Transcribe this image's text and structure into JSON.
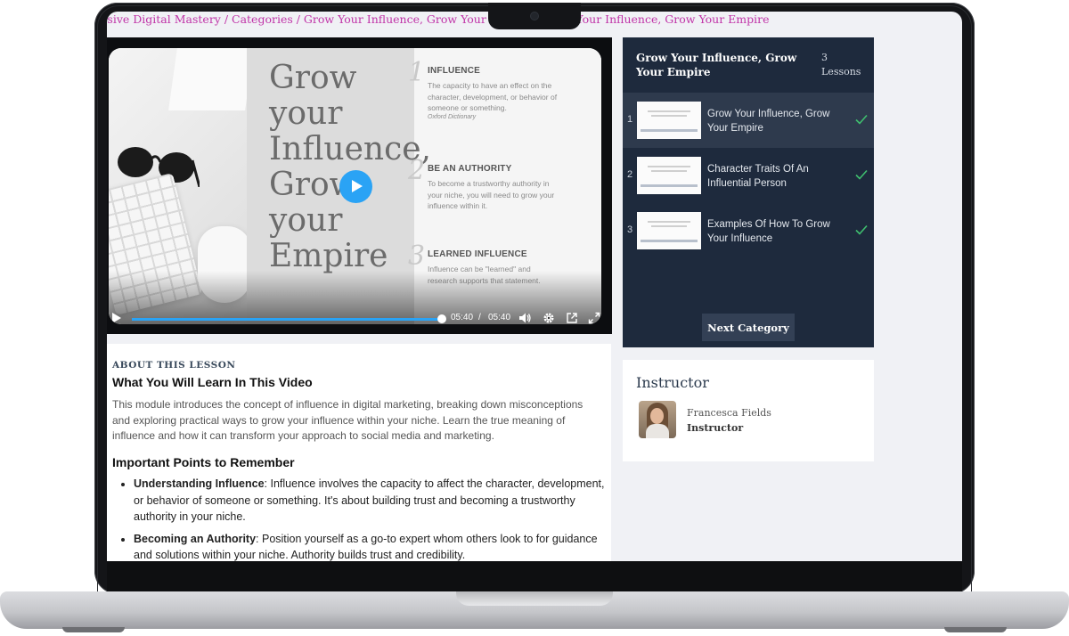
{
  "breadcrumb": "ssive Digital Mastery / Categories / Grow Your Influence, Grow Your Empire / Grow Your Influence, Grow Your Empire",
  "video": {
    "slide_title": "Grow your Influence, Grow your Empire",
    "slide_items": [
      {
        "num": "1",
        "heading": "INFLUENCE",
        "text": "The capacity to have an effect on the character, development, or behavior of someone or something.",
        "cite": "Oxford Dictionary"
      },
      {
        "num": "2",
        "heading": "BE AN AUTHORITY",
        "text": "To become a trustworthy authority in your niche, you will need to grow your influence within it.",
        "cite": ""
      },
      {
        "num": "3",
        "heading": "LEARNED INFLUENCE",
        "text": "Influence can be \"learned\" and research supports that statement.",
        "cite": ""
      }
    ],
    "current_time": "05:40",
    "separator": "/",
    "duration": "05:40",
    "progress": 1.0,
    "accent_color": "#2aa3f5"
  },
  "lesson": {
    "section_label": "ABOUT THIS LESSON",
    "heading": "What You Will Learn In This Video",
    "description": "This module introduces the concept of influence in digital marketing, breaking down misconceptions and exploring practical ways to grow your influence within your niche. Learn the true meaning of influence and how it can transform your approach to social media and marketing.",
    "points_heading": "Important Points to Remember",
    "points": [
      {
        "term": "Understanding Influence",
        "text": ": Influence involves the capacity to affect the character, development, or behavior of someone or something. It's about building trust and becoming a trustworthy authority in your niche."
      },
      {
        "term": "Becoming an Authority",
        "text": ": Position yourself as a go-to expert whom others look to for guidance and solutions within your niche. Authority builds trust and credibility."
      }
    ]
  },
  "sidebar": {
    "title": "Grow Your Influence, Grow Your Empire",
    "count": "3 Lessons",
    "items": [
      {
        "num": "1",
        "label": "Grow Your Influence, Grow Your Empire",
        "thumb_line": "GROW YOUR INFLUENCE GROW YOUR EMPIRE",
        "completed": true,
        "active": true
      },
      {
        "num": "2",
        "label": "Character Traits Of An Influential Person",
        "thumb_line": "GROW YOUR INFLUENCE GROW YOUR EMPIRE",
        "completed": true,
        "active": false
      },
      {
        "num": "3",
        "label": "Examples Of How To Grow Your Influence",
        "thumb_line": "GROW YOUR INFLUENCE GROW YOUR EMPIRE",
        "completed": true,
        "active": false
      }
    ],
    "next_button": "Next Category",
    "bg_color": "#1e2a3d",
    "check_color": "#3fbf6f"
  },
  "instructor": {
    "title": "Instructor",
    "name": "Francesca Fields",
    "role": "Instructor"
  }
}
